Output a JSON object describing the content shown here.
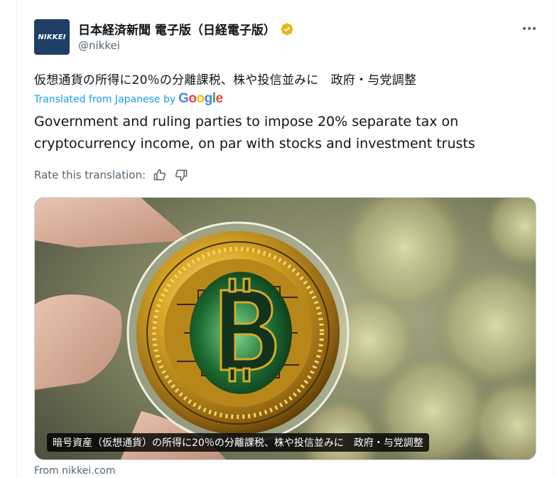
{
  "account": {
    "display_name": "日本経済新聞 電子版（日経電子版）",
    "handle": "@nikkei",
    "avatar_text": "NIKKEI",
    "verified": true
  },
  "post": {
    "original_text": "仮想通貨の所得に20％の分離課税、株や投信並みに　政府・与党調整",
    "translated_from": "Translated from Japanese by",
    "translation_provider": "Google",
    "translated_text": "Government and ruling parties to impose 20% separate tax on cryptocurrency income, on par with stocks and investment trusts",
    "rate_label": "Rate this translation:"
  },
  "card": {
    "caption": "暗号資産（仮想通貨）の所得に20％の分離課税、株や投信並みに　政府・与党調整",
    "source": "From nikkei.com"
  },
  "icons": {
    "more": "more-horizontal-icon",
    "verified": "verified-gold-badge-icon",
    "thumbs_up": "thumbs-up-icon",
    "thumbs_down": "thumbs-down-icon"
  },
  "colors": {
    "link": "#1d9bf0",
    "verified_gold": "#e2b719",
    "avatar_bg": "#1f3f66",
    "secondary_text": "#536471"
  }
}
